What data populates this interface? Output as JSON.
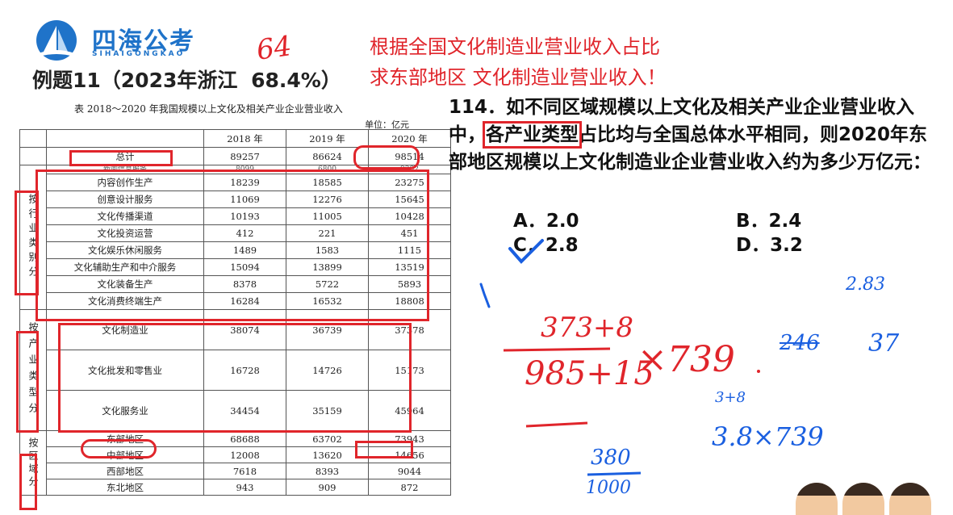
{
  "logo": {
    "name_cn": "四海公考",
    "name_en": "SIHAIGONGKAO",
    "brand_color": "#1f73c9"
  },
  "example_title": "例题11（2023年浙江",
  "example_pct": "68.4%）",
  "annotations_top": {
    "handwritten_64": "64"
  },
  "red_notes": [
    "根据全国文化制造业营业收入占比",
    "求东部地区  文化制造业营业收入！"
  ],
  "table": {
    "caption": "表   2018～2020 年我国规模以上文化及相关产业企业营业收入",
    "unit": "单位：亿元",
    "years": [
      "2018 年",
      "2019 年",
      "2020 年"
    ],
    "total": {
      "label": "总计",
      "values": [
        "89257",
        "86624",
        "98514"
      ]
    },
    "group_industry": {
      "label": "按行业类别分",
      "rows": [
        {
          "label": "新闻信息服务",
          "values": [
            "8099",
            "6800",
            "9382"
          ]
        },
        {
          "label": "内容创作生产",
          "values": [
            "18239",
            "18585",
            "23275"
          ]
        },
        {
          "label": "创意设计服务",
          "values": [
            "11069",
            "12276",
            "15645"
          ]
        },
        {
          "label": "文化传播渠道",
          "values": [
            "10193",
            "11005",
            "10428"
          ]
        },
        {
          "label": "文化投资运营",
          "values": [
            "412",
            "221",
            "451"
          ]
        },
        {
          "label": "文化娱乐休闲服务",
          "values": [
            "1489",
            "1583",
            "1115"
          ]
        },
        {
          "label": "文化辅助生产和中介服务",
          "values": [
            "15094",
            "13899",
            "13519"
          ]
        },
        {
          "label": "文化装备生产",
          "values": [
            "8378",
            "5722",
            "5893"
          ]
        },
        {
          "label": "文化消费终端生产",
          "values": [
            "16284",
            "16532",
            "18808"
          ]
        }
      ]
    },
    "group_type": {
      "label": "按产业类型分",
      "rows": [
        {
          "label": "文化制造业",
          "values": [
            "38074",
            "36739",
            "37378"
          ]
        },
        {
          "label": "文化批发和零售业",
          "values": [
            "16728",
            "14726",
            "15173"
          ]
        },
        {
          "label": "文化服务业",
          "values": [
            "34454",
            "35159",
            "45964"
          ]
        }
      ]
    },
    "group_region": {
      "label": "按区域分",
      "rows": [
        {
          "label": "东部地区",
          "values": [
            "68688",
            "63702",
            "73943"
          ]
        },
        {
          "label": "中部地区",
          "values": [
            "12008",
            "13620",
            "14656"
          ]
        },
        {
          "label": "西部地区",
          "values": [
            "7618",
            "8393",
            "9044"
          ]
        },
        {
          "label": "东北地区",
          "values": [
            "943",
            "909",
            "872"
          ]
        }
      ]
    }
  },
  "question": {
    "text_pre": "114．如不同区域规模以上文化及相关产业企业营业收入中，",
    "highlight": "各产业类型",
    "text_post": "占比均与全国总体水平相同，则2020年东部地区规模以上文化制造业企业营业收入约为多少万亿元：",
    "options": [
      {
        "letter": "A．",
        "value": "2.0"
      },
      {
        "letter": "B．",
        "value": "2.4"
      },
      {
        "letter": "C．",
        "value": "2.8"
      },
      {
        "letter": "D．",
        "value": "3.2"
      }
    ]
  },
  "handwriting": {
    "frac_num": "373+8",
    "frac_den": "985+15",
    "times": "×739",
    "blue_283": "2.83",
    "blue_246": "246",
    "blue_37": "37",
    "blue_frac_num": "380",
    "blue_frac_den": "1000",
    "blue_sum": "3+8",
    "blue_expr": "3.8×739"
  },
  "colors": {
    "annotation_red": "#e0252b",
    "annotation_blue": "#1a5fe0"
  }
}
